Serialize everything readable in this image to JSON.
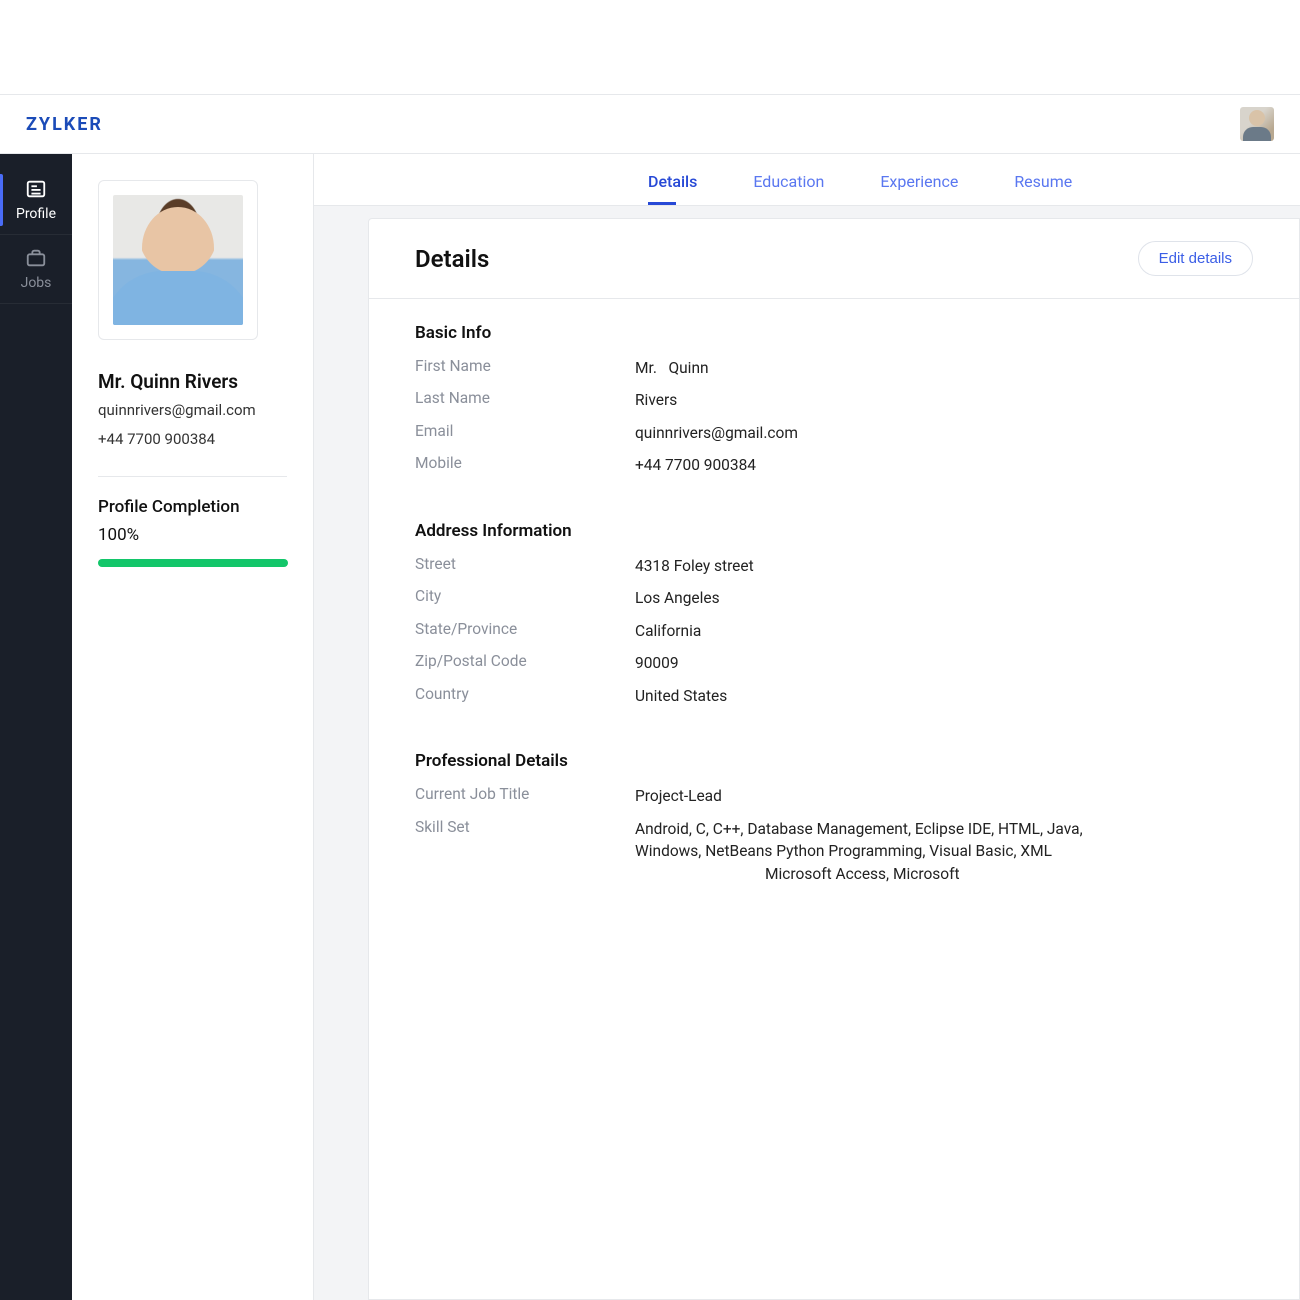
{
  "header": {
    "logo": "ZYLKER"
  },
  "nav": {
    "items": [
      {
        "label": "Profile",
        "icon": "profile-card-icon",
        "active": true
      },
      {
        "label": "Jobs",
        "icon": "briefcase-icon",
        "active": false
      }
    ]
  },
  "summary": {
    "full_name": "Mr. Quinn Rivers",
    "email": "quinnrivers@gmail.com",
    "phone": "+44 7700 900384",
    "completion_label": "Profile Completion",
    "completion_value": "100%"
  },
  "tabs": [
    {
      "label": "Details",
      "active": true
    },
    {
      "label": "Education",
      "active": false
    },
    {
      "label": "Experience",
      "active": false
    },
    {
      "label": "Resume",
      "active": false
    }
  ],
  "details": {
    "heading": "Details",
    "edit_label": "Edit details",
    "sections": {
      "basic": {
        "title": "Basic Info",
        "first_name_label": "First Name",
        "first_name_value": "Mr.   Quinn",
        "last_name_label": "Last Name",
        "last_name_value": "Rivers",
        "email_label": "Email",
        "email_value": "quinnrivers@gmail.com",
        "mobile_label": "Mobile",
        "mobile_value": "+44 7700 900384"
      },
      "address": {
        "title": "Address Information",
        "street_label": "Street",
        "street_value": "4318 Foley street",
        "city_label": "City",
        "city_value": "Los Angeles",
        "state_label": "State/Province",
        "state_value": "California",
        "zip_label": "Zip/Postal Code",
        "zip_value": "90009",
        "country_label": "Country",
        "country_value": "United States"
      },
      "professional": {
        "title": "Professional Details",
        "job_label": "Current Job Title",
        "job_value": "Project-Lead",
        "skill_label": "Skill Set",
        "skill_line1": "Android, C, C++, Database Management, Eclipse IDE, HTML, Java,",
        "skill_line2": "Windows, NetBeans Python Programming, Visual Basic, XML",
        "skill_line3": "Microsoft Access, Microsoft"
      }
    }
  }
}
